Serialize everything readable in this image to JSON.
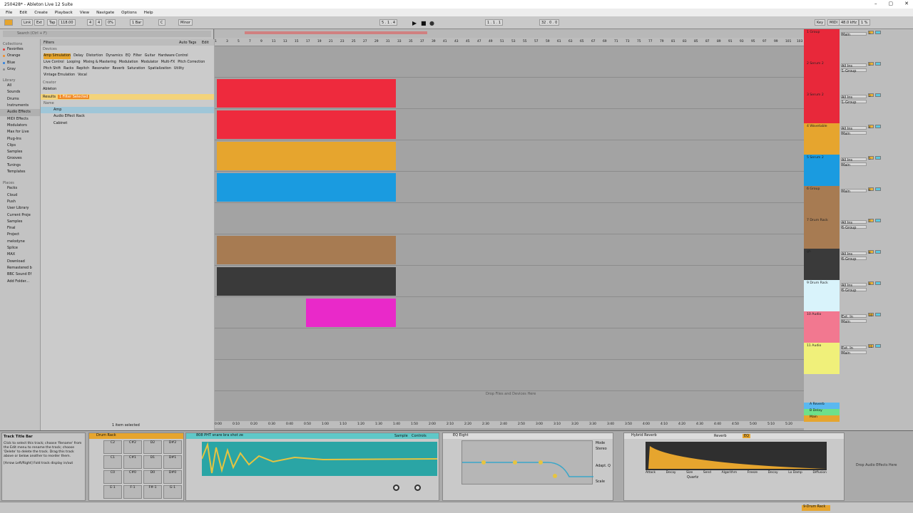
{
  "window": {
    "title": "250428* - Ableton Live 12 Suite"
  },
  "menu": [
    "File",
    "Edit",
    "Create",
    "Playback",
    "View",
    "Navigate",
    "Options",
    "Help"
  ],
  "transport": {
    "link": "Link",
    "ext": "Ext",
    "tap": "Tap",
    "tempo": "118.00",
    "meter_num": "4",
    "meter_den": "4",
    "swing": "0%",
    "quant": "1 Bar",
    "key": "C",
    "scale": "Minor",
    "position": "5 . 1 . 4",
    "loop_start": "1 . 1 . 1",
    "loop_len": "32 . 0 . 0",
    "key_label": "Key",
    "midi_label": "MIDI",
    "sample_rate": "48.0 kHz",
    "cpu": "1 %"
  },
  "browser": {
    "search_placeholder": "Search (Ctrl + F)",
    "collections_label": "Collections",
    "collections": [
      {
        "name": "Favorites",
        "color": "#e23b3b"
      },
      {
        "name": "Orange",
        "color": "#f08a24"
      },
      {
        "name": "Blue",
        "color": "#2b7fe0"
      },
      {
        "name": "Gray",
        "color": "#888888"
      }
    ],
    "library_label": "Library",
    "library": [
      "All",
      "Sounds",
      "Drums",
      "Instruments",
      "Audio Effects",
      "MIDI Effects",
      "Modulators",
      "Max for Live",
      "Plug-Ins",
      "Clips",
      "Samples",
      "Grooves",
      "Tunings",
      "Templates"
    ],
    "places_label": "Places",
    "places": [
      "Packs",
      "Cloud",
      "Push",
      "User Library",
      "Current Proje",
      "Samples",
      "Final",
      "Project",
      "melodyne",
      "Splice",
      "MAX",
      "Download",
      "Remastered b",
      "BBC Sound Ef",
      "Add Folder..."
    ],
    "filters_label": "Filters",
    "auto_tags": "Auto Tags",
    "edit": "Edit",
    "devices_label": "Devices",
    "filter_tags": [
      "Amp Simulation",
      "Delay",
      "Distortion",
      "Dynamics",
      "EQ",
      "Filter",
      "Guitar",
      "Hardware Control",
      "Live Control",
      "Looping",
      "Mixing & Mastering",
      "Modulation",
      "Modulator",
      "Multi-FX",
      "Pitch Correction",
      "Pitch Shift",
      "Racks",
      "Repitch",
      "Resonator",
      "Reverb",
      "Saturation",
      "Spatialization",
      "Utility",
      "Vintage Emulation",
      "Vocal"
    ],
    "creator_label": "Creator",
    "creator_value": "Ableton",
    "results_label": "Results",
    "results_badge": "1 Filter Selected",
    "name_col": "Name",
    "results": [
      "Amp",
      "Audio Effect Rack",
      "Cabinet"
    ],
    "footer": "1 item selected"
  },
  "arrangement": {
    "ruler": [
      "1",
      "3",
      "5",
      "7",
      "9",
      "11",
      "13",
      "15",
      "17",
      "19",
      "21",
      "23",
      "25",
      "27",
      "29",
      "31",
      "33",
      "35",
      "37",
      "39",
      "41",
      "43",
      "45",
      "47",
      "49",
      "51",
      "53",
      "55",
      "57",
      "59",
      "61",
      "63",
      "65",
      "67",
      "69",
      "71",
      "73",
      "75",
      "77",
      "79",
      "81",
      "83",
      "85",
      "87",
      "89",
      "91",
      "93",
      "95",
      "97",
      "99",
      "101",
      "103"
    ],
    "drop_hint": "Drop Files and Devices Here",
    "time_ruler": [
      "0:00",
      "0:10",
      "0:20",
      "0:30",
      "0:40",
      "0:50",
      "1:00",
      "1:10",
      "1:20",
      "1:30",
      "1:40",
      "1:50",
      "2:00",
      "2:10",
      "2:20",
      "2:30",
      "2:40",
      "2:50",
      "3:00",
      "3:10",
      "3:20",
      "3:30",
      "3:40",
      "3:50",
      "4:00",
      "4:10",
      "4:20",
      "4:30",
      "4:40",
      "4:50",
      "5:00",
      "5:10",
      "5:20"
    ]
  },
  "tracks": [
    {
      "name": "1 Group",
      "color": "#e8283a",
      "clip_color": "#f0f0f0",
      "input": "",
      "route": "Main",
      "num": "1"
    },
    {
      "name": "2 Serum 2",
      "color": "#e8283a",
      "clip_color": "#ee2a3d",
      "input": "All Ins",
      "route": "1-Group",
      "num": "2"
    },
    {
      "name": "3 Serum 2",
      "color": "#e8283a",
      "clip_color": "#ee2a3d",
      "input": "All Ins",
      "route": "1-Group",
      "num": "3"
    },
    {
      "name": "4 Wavetable",
      "color": "#e6a52e",
      "clip_color": "#e6a52e",
      "input": "All Ins",
      "route": "Main",
      "num": "4"
    },
    {
      "name": "5 Serum 2",
      "color": "#1a9be0",
      "clip_color": "#1a9be0",
      "input": "All Ins",
      "route": "Main",
      "num": "5"
    },
    {
      "name": "6 Group",
      "color": "#a77b52",
      "clip_color": "",
      "input": "",
      "route": "Main",
      "num": "6"
    },
    {
      "name": "7 Drum Rack",
      "color": "#a77b52",
      "clip_color": "#a77b52",
      "input": "All Ins",
      "route": "6-Group",
      "num": "7"
    },
    {
      "name": "gh",
      "color": "#3a3a3a",
      "clip_color": "#3a3a3a",
      "input": "All Ins",
      "route": "6-Group",
      "num": "8"
    },
    {
      "name": "9 Drum Rack",
      "color": "#d9f3fb",
      "clip_color": "#e929c9",
      "input": "All Ins",
      "route": "6-Group",
      "num": "9"
    },
    {
      "name": "10 Audio",
      "color": "#f27890",
      "clip_color": "",
      "input": "Ext. In",
      "route": "Main",
      "num": "10"
    },
    {
      "name": "11 Audio",
      "color": "#f0f07a",
      "clip_color": "",
      "input": "Ext. In",
      "route": "Main",
      "num": "11"
    }
  ],
  "returns": [
    {
      "name": "A Reverb",
      "color": "#5ab8f0",
      "num": "A"
    },
    {
      "name": "B Delay",
      "color": "#6ee08a",
      "num": "B"
    },
    {
      "name": "Main",
      "color": "#e6a52e",
      "num": "0"
    }
  ],
  "info": {
    "title": "Track Title Bar",
    "text": "Click to select this track; choose 'Rename' from the Edit menu to rename the track; choose 'Delete' to delete the track. Drag this track above or below another to reorder them.",
    "hint": "[Arrow Left/Right] Fold track display in/out"
  },
  "devices": {
    "drum_rack": "Drum Rack",
    "pads": [
      "C2",
      "C#2",
      "D2",
      "D#2",
      "C1",
      "C#1",
      "D1",
      "D#1",
      "C0",
      "C#0",
      "D0",
      "D#0",
      "E-1",
      "F-1",
      "F#-1",
      "G-1"
    ],
    "simpler": "808  PHT snare  bra  shot  ze",
    "simpler_tabs": [
      "Sample",
      "Controls"
    ],
    "eq": "EQ Eight",
    "eq_mode": "Mode",
    "eq_stereo": "Stereo",
    "eq_adapt": "Adapt. Q",
    "eq_scale": "Scale",
    "reverb": "Hybrid Reverb",
    "reverb_tabs": [
      "Reverb",
      "EQ"
    ],
    "reverb_labels": [
      "Attack",
      "Decay",
      "Size",
      "Send",
      "Algorithm",
      "Freeze",
      "Decay",
      "Lo Damp",
      "Diffusion"
    ],
    "reverb_algo": "Quartz",
    "drop_hint": "Drop Audio Effects Here"
  },
  "status": {
    "track": "9-Drum Rack"
  }
}
